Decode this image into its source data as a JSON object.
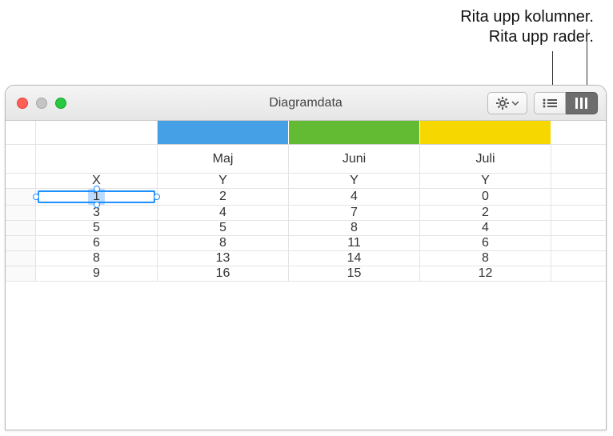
{
  "callouts": {
    "columns": "Rita upp kolumner.",
    "rows": "Rita upp rader."
  },
  "window": {
    "title": "Diagramdata"
  },
  "colors": [
    "#45a0e6",
    "#62bb32",
    "#f7d700"
  ],
  "columns": {
    "months": [
      "Maj",
      "Juni",
      "Juli"
    ],
    "axes": [
      "X",
      "Y",
      "Y",
      "Y"
    ]
  },
  "selected_cell": {
    "row": 0,
    "col": 0
  },
  "chart_data": {
    "type": "table",
    "x": [
      1,
      3,
      5,
      6,
      8,
      9
    ],
    "series": [
      {
        "name": "Maj",
        "values": [
          2,
          4,
          5,
          8,
          13,
          16
        ]
      },
      {
        "name": "Juni",
        "values": [
          4,
          7,
          8,
          11,
          14,
          15
        ]
      },
      {
        "name": "Juli",
        "values": [
          0,
          2,
          4,
          6,
          8,
          12
        ]
      }
    ]
  }
}
